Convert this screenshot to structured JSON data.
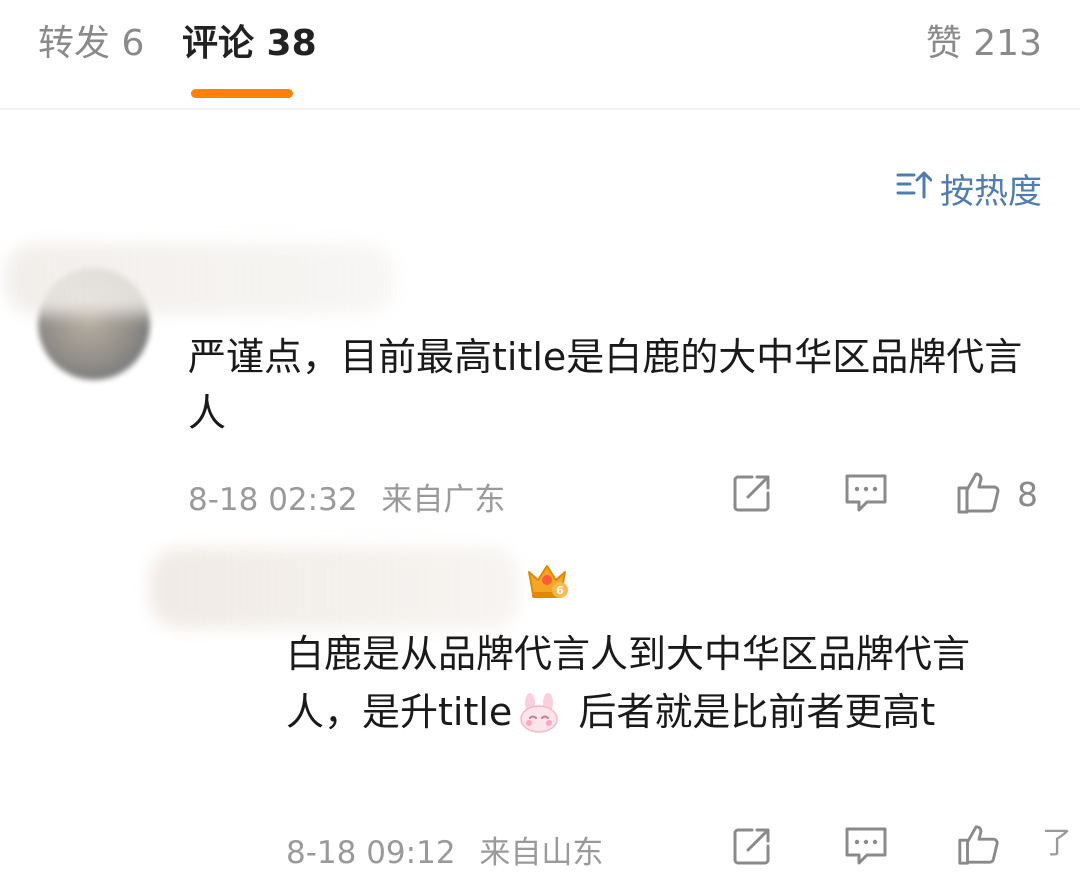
{
  "tabs": {
    "repost": "转发 6",
    "comments": "评论 38",
    "likes": "赞 213"
  },
  "sort": {
    "label": "按热度",
    "icon": "sort-icon"
  },
  "comments": [
    {
      "text": "严谨点，目前最高title是白鹿的大中华区品牌代言人",
      "time": "8-18 02:32",
      "location": "来自广东",
      "like_count": "8"
    },
    {
      "text_before": "白鹿是从品牌代言人到大中华区品牌代言人，是升title",
      "emoji": "bunny-emoji",
      "text_after": " 后者就是比前者更高t",
      "time": "8-18 09:12",
      "location": "来自山东",
      "badge": "6",
      "corner_text": "了"
    }
  ],
  "colors": {
    "accent": "#ff8200",
    "link": "#507daf",
    "meta": "#9a9a9a"
  }
}
